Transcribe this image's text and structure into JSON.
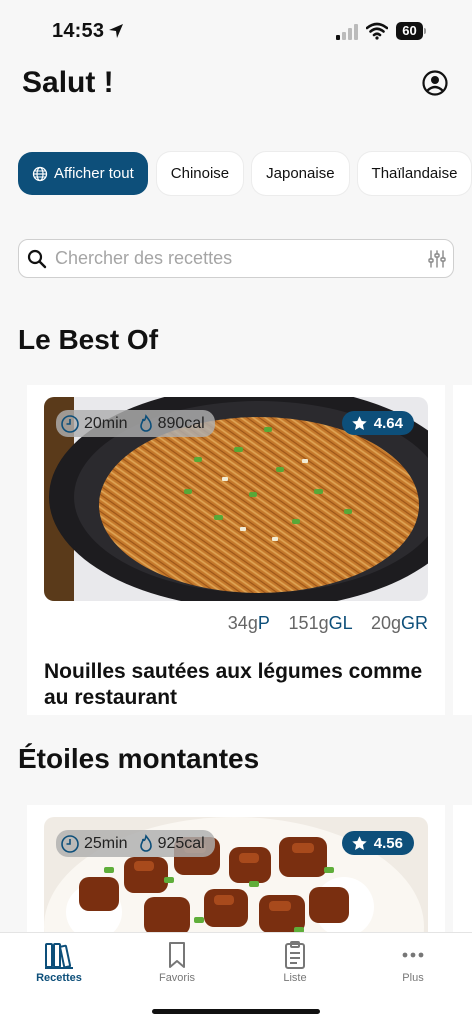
{
  "status_bar": {
    "time": "14:53",
    "battery": "60"
  },
  "header": {
    "greeting": "Salut !"
  },
  "filters": [
    {
      "label": "Afficher tout"
    },
    {
      "label": "Chinoise"
    },
    {
      "label": "Japonaise"
    },
    {
      "label": "Thaïlandaise"
    }
  ],
  "search": {
    "placeholder": "Chercher des recettes",
    "value": ""
  },
  "sections": [
    {
      "title": "Le Best Of",
      "card": {
        "time": "20min",
        "calories": "890cal",
        "rating": "4.64",
        "protein_value": "34g",
        "protein_unit": "P",
        "carbs_value": "151g",
        "carbs_unit": "GL",
        "fat_value": "20g",
        "fat_unit": "GR",
        "title": "Nouilles sautées aux légumes comme au restaurant"
      }
    },
    {
      "title": "Étoiles montantes",
      "card": {
        "time": "25min",
        "calories": "925cal",
        "rating": "4.56"
      }
    }
  ],
  "tabbar": [
    {
      "label": "Recettes",
      "icon": "books-icon"
    },
    {
      "label": "Favoris",
      "icon": "bookmark-icon"
    },
    {
      "label": "Liste",
      "icon": "clipboard-icon"
    },
    {
      "label": "Plus",
      "icon": "more-icon"
    }
  ],
  "colors": {
    "accent": "#0d4f7a",
    "background": "#f7f7f7"
  }
}
